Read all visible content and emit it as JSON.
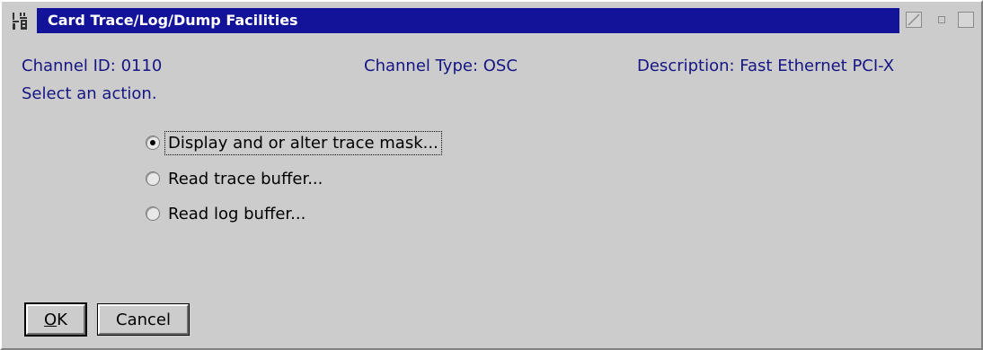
{
  "window": {
    "title": "Card Trace/Log/Dump Facilities",
    "title_bar_color": "#13139a"
  },
  "info": {
    "channel_id": "Channel ID: 0110",
    "channel_type": "Channel Type: OSC",
    "description": "Description: Fast Ethernet PCI-X",
    "instruction": "Select an action."
  },
  "options": [
    {
      "label": "Display and or alter trace mask...",
      "selected": true
    },
    {
      "label": "Read trace buffer...",
      "selected": false
    },
    {
      "label": "Read log buffer...",
      "selected": false
    }
  ],
  "buttons": {
    "ok_label": "OK",
    "cancel_label": "Cancel"
  },
  "colors": {
    "text_accent": "#151583",
    "background": "#cccccc"
  },
  "icons": {
    "system_menu": "system-menu-icon",
    "hide": "hide-icon",
    "restore": "restore-icon",
    "maximize": "maximize-icon"
  }
}
